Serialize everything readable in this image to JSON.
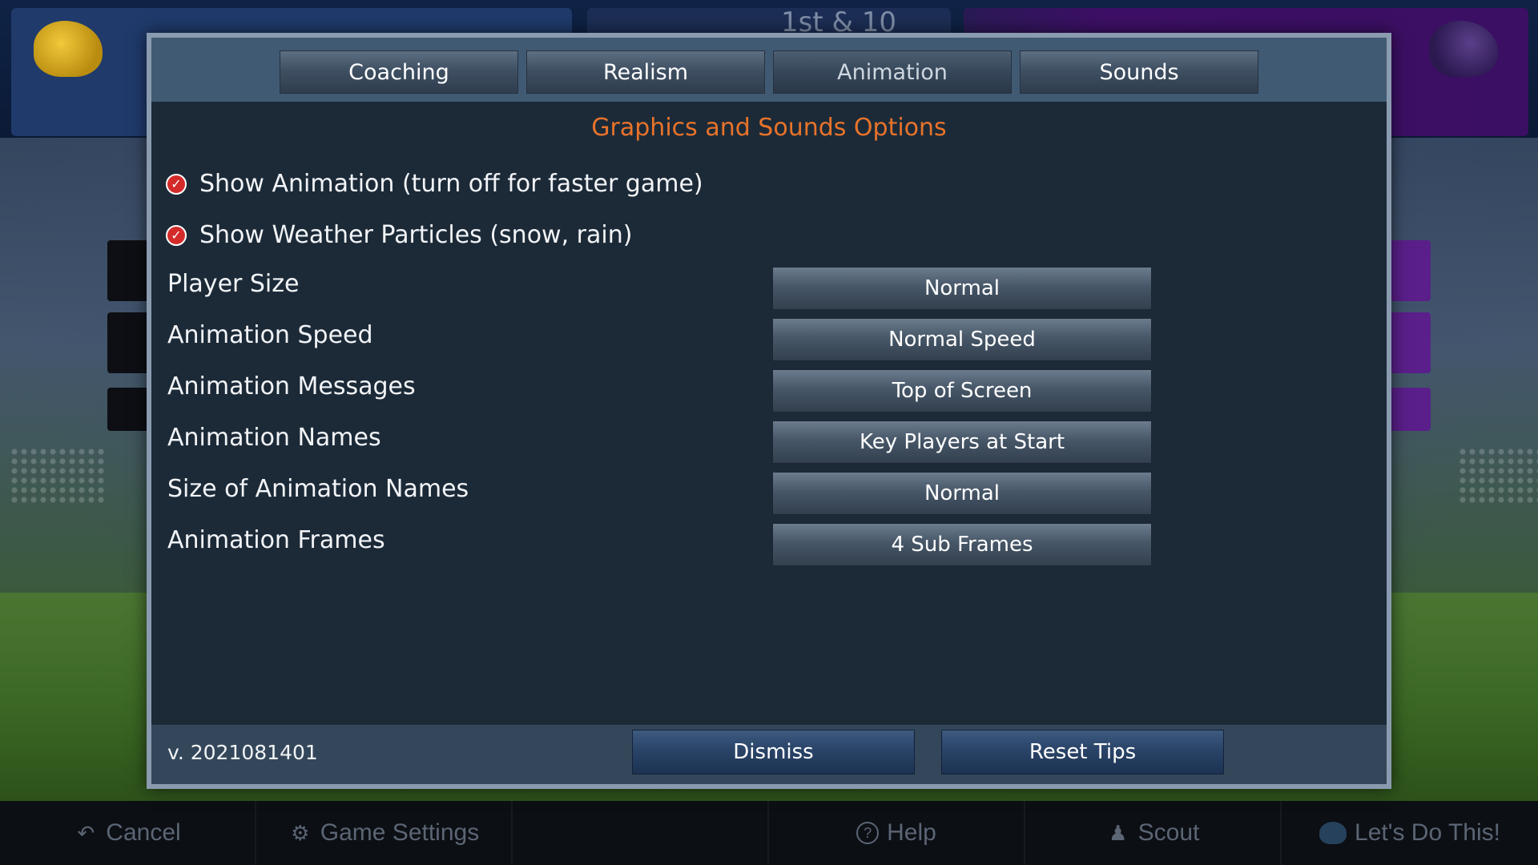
{
  "scoreboard": {
    "down_distance": "1st & 10"
  },
  "tabs": [
    {
      "label": "Coaching"
    },
    {
      "label": "Realism"
    },
    {
      "label": "Animation"
    },
    {
      "label": "Sounds"
    }
  ],
  "active_tab": "Animation",
  "dialog": {
    "title": "Graphics and Sounds Options",
    "checkboxes": [
      {
        "label": "Show Animation (turn off for faster game)",
        "checked": true
      },
      {
        "label": "Show Weather Particles (snow, rain)",
        "checked": true
      }
    ],
    "options": [
      {
        "label": "Player Size",
        "value": "Normal"
      },
      {
        "label": "Animation Speed",
        "value": "Normal Speed"
      },
      {
        "label": "Animation Messages",
        "value": "Top of Screen"
      },
      {
        "label": "Animation Names",
        "value": "Key Players at Start"
      },
      {
        "label": "Size of Animation Names",
        "value": "Normal"
      },
      {
        "label": "Animation Frames",
        "value": "4 Sub Frames"
      }
    ],
    "footer": {
      "version": "v. 2021081401",
      "dismiss_label": "Dismiss",
      "reset_tips_label": "Reset Tips"
    }
  },
  "bottom_bar": [
    {
      "label": "Cancel",
      "icon": "undo-arrow-icon"
    },
    {
      "label": "Game Settings",
      "icon": "gear-icon"
    },
    {
      "label": "",
      "icon": ""
    },
    {
      "label": "Help",
      "icon": "help-circle-icon"
    },
    {
      "label": "Scout",
      "icon": "person-icon"
    },
    {
      "label": "Let's Do This!",
      "icon": "helmet-icon"
    }
  ],
  "colors": {
    "title_accent": "#e8732a",
    "check_red": "#d42a2a",
    "modal_bg": "#1c2a38"
  }
}
